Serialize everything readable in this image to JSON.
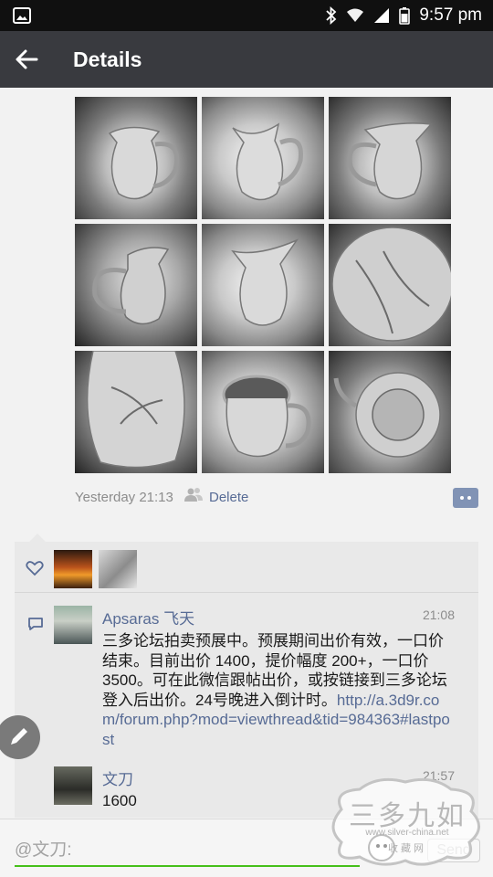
{
  "status_bar": {
    "time": "9:57 pm",
    "icons": [
      "image-icon",
      "bluetooth-icon",
      "wifi-icon",
      "signal-icon",
      "battery-icon"
    ]
  },
  "app_bar": {
    "title": "Details",
    "back_icon": "arrow-left-icon"
  },
  "post": {
    "photos": [
      {
        "subject": "silver pitcher, front"
      },
      {
        "subject": "silver pitcher, side"
      },
      {
        "subject": "silver pitcher, back"
      },
      {
        "subject": "silver pitcher, handle view"
      },
      {
        "subject": "silver pitcher, spout view"
      },
      {
        "subject": "engraved detail"
      },
      {
        "subject": "engraved floral detail"
      },
      {
        "subject": "pitcher interior"
      },
      {
        "subject": "pitcher base hallmark"
      }
    ],
    "timestamp": "Yesterday 21:13",
    "delete_label": "Delete",
    "comment_button_icon": "comment-dots-icon"
  },
  "likes": {
    "icon": "heart-icon",
    "avatars": [
      "sunset-couple-avatar",
      "silver-earrings-avatar"
    ]
  },
  "comments": [
    {
      "author": "Apsaras 飞天",
      "time": "21:08",
      "text": "三多论坛拍卖预展中。预展期间出价有效，一口价结束。目前出价 1400，提价幅度 200+，一口价 3500。可在此微信跟帖出价，或按链接到三多论坛登入后出价。24号晚进入倒计时。",
      "link": "http://a.3d9r.com/forum.php?mod=viewthread&tid=984363#lastpost"
    },
    {
      "author": "文刀",
      "time": "21:57",
      "text": "1600"
    }
  ],
  "input": {
    "placeholder": "@文刀:",
    "send_label": "Send"
  },
  "watermark": {
    "title": "三多九如",
    "url": "www.silver-china.net",
    "subtitle": "收藏网"
  },
  "colors": {
    "app_bar": "#393a3f",
    "link": "#576b95",
    "input_underline": "#45c01a",
    "panel": "#e9e9e9"
  }
}
